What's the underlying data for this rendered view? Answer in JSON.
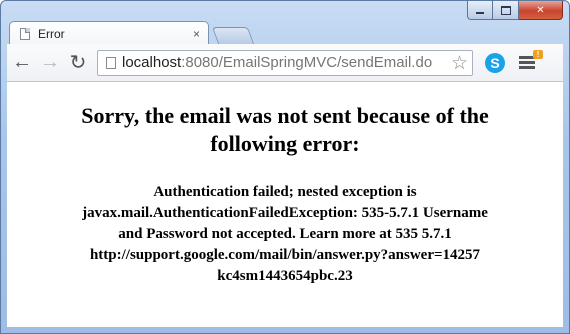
{
  "browser": {
    "tab_title": "Error",
    "tab_close": "×",
    "url_host": "localhost",
    "url_rest": ":8080/EmailSpringMVC/sendEmail.do",
    "back_icon": "←",
    "forward_icon": "→",
    "reload_icon": "↻",
    "star_icon": "☆",
    "skype_label": "S",
    "menu_badge": "!",
    "close_icon": "✕"
  },
  "page": {
    "heading": "Sorry, the email was not sent because of the following error:",
    "lines": [
      "Authentication failed; nested exception is",
      "javax.mail.AuthenticationFailedException: 535-5.7.1 Username",
      "and Password not accepted. Learn more at 535 5.7.1",
      "http://support.google.com/mail/bin/answer.py?answer=14257",
      "kc4sm1443654pbc.23"
    ]
  }
}
